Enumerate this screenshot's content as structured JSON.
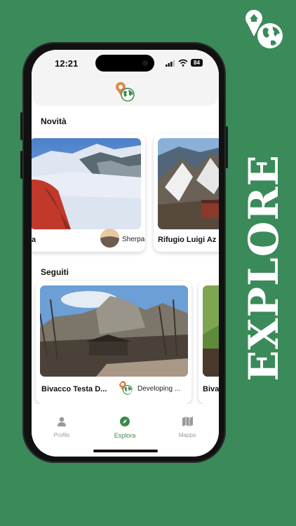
{
  "status_bar": {
    "time": "12:21",
    "battery": "84"
  },
  "sections": {
    "new_label": "Novità",
    "followed_label": "Seguiti"
  },
  "new_cards": [
    {
      "title": "a",
      "author": "SherpaGeo"
    },
    {
      "title": "Rifugio Luigi Az"
    }
  ],
  "followed_cards": [
    {
      "title": "Bivacco Testa D...",
      "author": "Developing ..."
    },
    {
      "title": "Biva"
    }
  ],
  "tabs": [
    {
      "label": "Profilo",
      "icon": "person-icon"
    },
    {
      "label": "Esplora",
      "icon": "compass-icon",
      "active": true
    },
    {
      "label": "Mappa",
      "icon": "map-icon"
    }
  ],
  "promo": {
    "text": "EXPLORE"
  },
  "colors": {
    "brand_green": "#3a8a5a",
    "active_tab": "#3a8a4a"
  }
}
